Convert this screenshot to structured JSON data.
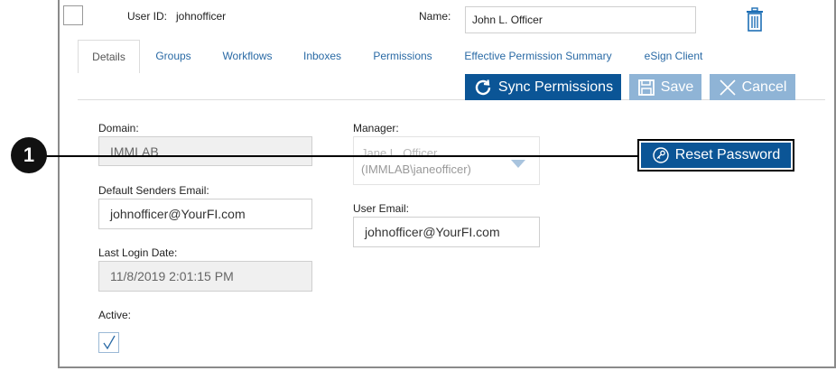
{
  "header": {
    "user_id_label": "User ID:",
    "user_id_value": "johnofficer",
    "name_label": "Name:",
    "name_value": "John L. Officer"
  },
  "tabs": [
    {
      "label": "Details",
      "active": true
    },
    {
      "label": "Groups"
    },
    {
      "label": "Workflows"
    },
    {
      "label": "Inboxes"
    },
    {
      "label": "Permissions"
    },
    {
      "label": "Effective Permission Summary"
    },
    {
      "label": "eSign Client"
    }
  ],
  "toolbar": {
    "sync_label": "Sync Permissions",
    "save_label": "Save",
    "cancel_label": "Cancel"
  },
  "form": {
    "domain_label": "Domain:",
    "domain_value": "IMMLAB",
    "manager_label": "Manager:",
    "manager_line1": "Jane L. Officer",
    "manager_line2": "(IMMLAB\\janeofficer)",
    "default_email_label": "Default Senders Email:",
    "default_email_value": "johnofficer@YourFI.com",
    "user_email_label": "User Email:",
    "user_email_value": "johnofficer@YourFI.com",
    "last_login_label": "Last Login Date:",
    "last_login_value": "11/8/2019 2:01:15 PM",
    "active_label": "Active:",
    "active_checked": true
  },
  "actions": {
    "reset_password_label": "Reset Password"
  },
  "callout": {
    "number": "1"
  },
  "colors": {
    "primary": "#0b5596",
    "disabled": "#8fb4d6",
    "link": "#2a6aa5"
  }
}
